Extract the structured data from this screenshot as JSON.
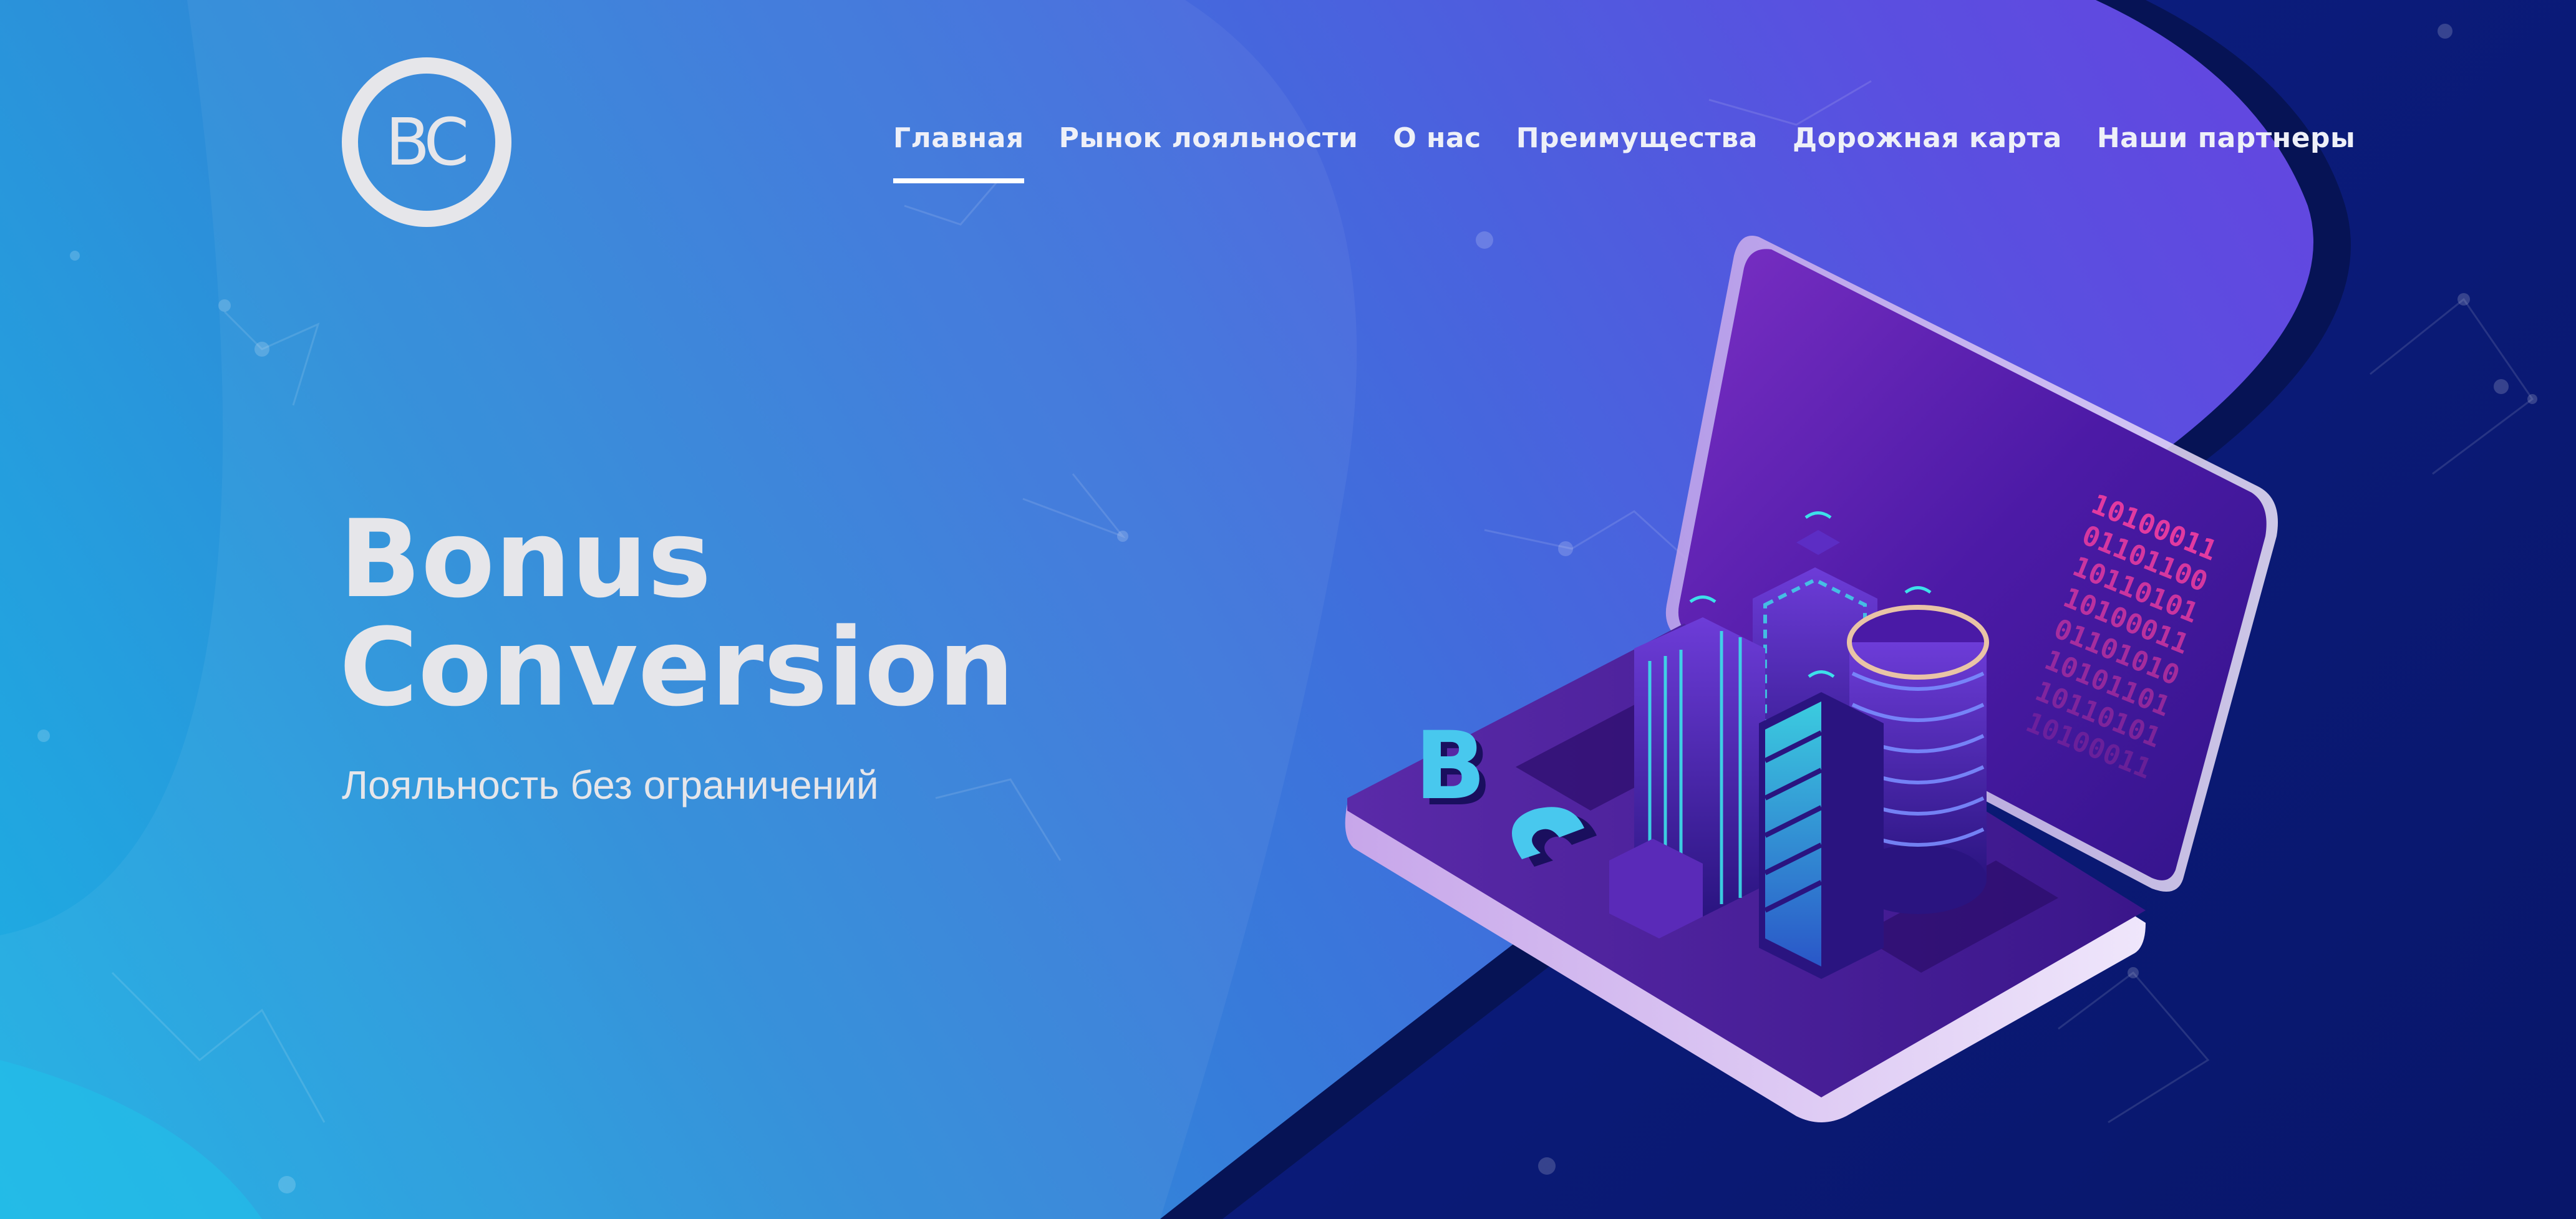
{
  "logo": {
    "text": "BC"
  },
  "nav": {
    "items": [
      {
        "label": "Главная",
        "active": true
      },
      {
        "label": "Рынок лояльности",
        "active": false
      },
      {
        "label": "О нас",
        "active": false
      },
      {
        "label": "Преимущества",
        "active": false
      },
      {
        "label": "Дорожная карта",
        "active": false
      },
      {
        "label": "Наши партнеры",
        "active": false
      }
    ]
  },
  "hero": {
    "title_line1": "Bonus",
    "title_line2": "Conversion",
    "subtitle": "Лояльность без ограничений"
  },
  "illustration": {
    "binary_lines": [
      "10100011",
      "01101100",
      "10110101",
      "10100011",
      "01101010",
      "10101101",
      "10110101",
      "10100011"
    ],
    "letter_b": "B",
    "letter_c": "C"
  },
  "colors": {
    "gradient_start": "#1cb0e3",
    "gradient_end": "#6a3fe0",
    "dark_navy": "#0a1a6e",
    "laptop_purple": "#4a1a9e",
    "text_light": "#e6e6ea"
  }
}
